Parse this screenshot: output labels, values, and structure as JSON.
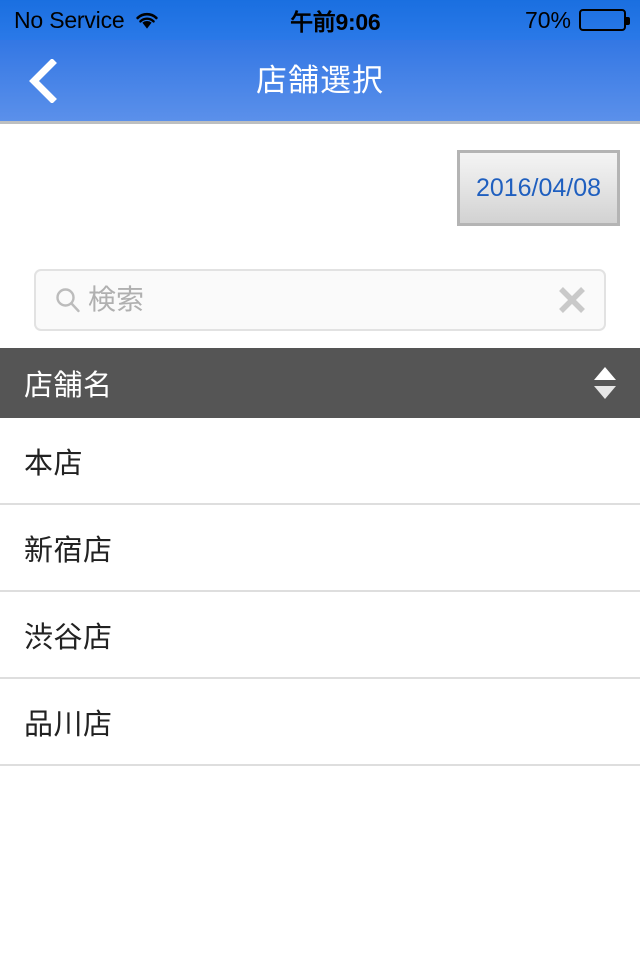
{
  "status_bar": {
    "carrier": "No Service",
    "wifi_icon": "wifi-icon",
    "time": "午前9:06",
    "battery_percent": "70%",
    "battery_level": 70
  },
  "nav_bar": {
    "back_icon": "chevron-left-icon",
    "title": "店舗選択"
  },
  "toolbar": {
    "date_button_label": "2016/04/08"
  },
  "search": {
    "icon": "search-icon",
    "value": "",
    "placeholder": "検索",
    "clear_icon": "close-icon"
  },
  "table": {
    "header": {
      "column_label": "店舗名",
      "sort_icon": "sort-updown-icon"
    },
    "rows": [
      {
        "name": "本店"
      },
      {
        "name": "新宿店"
      },
      {
        "name": "渋谷店"
      },
      {
        "name": "品川店"
      }
    ]
  },
  "colors": {
    "status_bar_blue": "#1a6fe0",
    "nav_bar_blue": "#3377e4",
    "nav_bar_blue_light": "#5b90ea",
    "table_header_gray": "#555555",
    "date_text_blue": "#1f5fbf",
    "separator_gray": "#dedede"
  }
}
